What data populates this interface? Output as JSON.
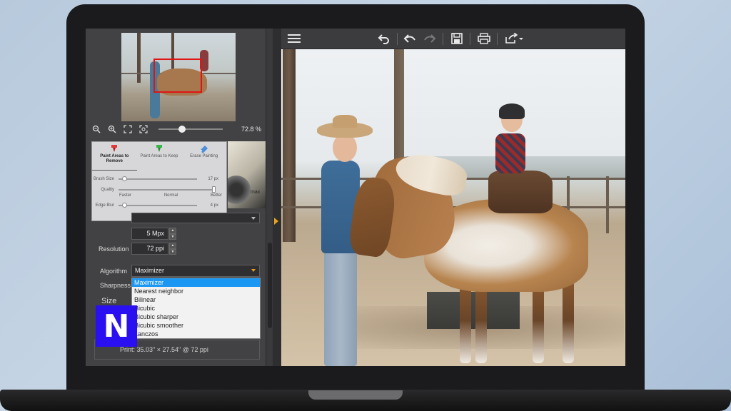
{
  "device": {
    "type": "laptop"
  },
  "navigator": {
    "zoom_value": "72.8 %",
    "zoom_level": 0.35,
    "icons": [
      "zoom-out-icon",
      "zoom-in-icon",
      "fit-to-screen-icon",
      "actual-size-icon"
    ]
  },
  "tool_popup": {
    "tabs": [
      {
        "label": "Paint Areas to Remove",
        "icon": "remove-brush-icon",
        "color": "#e03a3a",
        "active": true
      },
      {
        "label": "Paint Areas to Keep",
        "icon": "keep-brush-icon",
        "color": "#3ab54a",
        "active": false
      },
      {
        "label": "Erase Painting",
        "icon": "eraser-icon",
        "color": "#4a90d9",
        "active": false
      }
    ],
    "brush_size": {
      "label": "Brush Size",
      "value": "17 px",
      "level": 0.05
    },
    "quality": {
      "label": "Quality",
      "level": 1.0,
      "ticks": [
        "Faster",
        "Normal",
        "Better"
      ]
    },
    "edge_blur": {
      "label": "Edge Blur",
      "value": "4 px",
      "level": 0.05
    }
  },
  "thumbnail": {
    "text": "max"
  },
  "resize": {
    "pixels_value": "5 Mpx",
    "resolution_label": "Resolution",
    "resolution_value": "72 ppi",
    "algorithm_label": "Algorithm",
    "algorithm_value": "Maximizer",
    "sharpness_label": "Sharpness",
    "size_label": "Size",
    "print_info": "Print: 35.03\" × 27.54\" @ 72 ppi",
    "options": [
      "Maximizer",
      "Nearest neighbor",
      "Bilinear",
      "Bicubic",
      "Bicubic sharper",
      "Bicubic smoother",
      "Lanczos"
    ],
    "selected_option": "Maximizer"
  },
  "brand": {
    "logo_letter": "N",
    "logo_color": "#2a10f0"
  },
  "toolbar": {
    "icons": [
      "menu-icon",
      "undo-all-icon",
      "undo-icon",
      "redo-icon",
      "save-icon",
      "print-icon",
      "export-icon"
    ]
  },
  "colors": {
    "accent": "#e6a11f",
    "selection": "#1a96f3",
    "viewport": "#e01414"
  }
}
